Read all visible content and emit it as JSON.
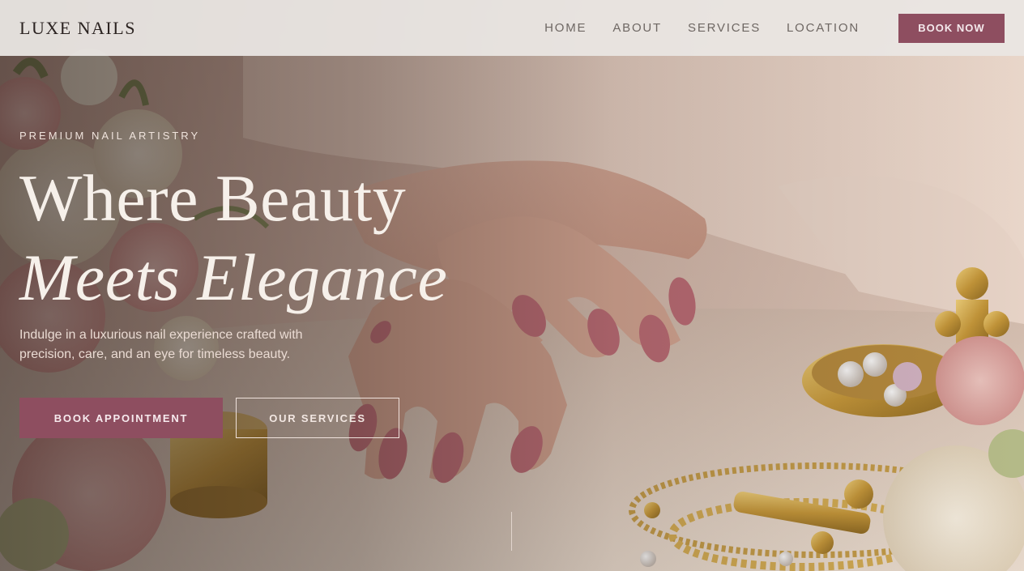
{
  "header": {
    "brand": "LUXE NAILS",
    "nav": [
      {
        "label": "HOME"
      },
      {
        "label": "ABOUT"
      },
      {
        "label": "SERVICES"
      },
      {
        "label": "LOCATION"
      }
    ],
    "book_now_label": "BOOK NOW"
  },
  "hero": {
    "eyebrow": "PREMIUM NAIL ARTISTRY",
    "headline_line_1": "Where Beauty",
    "headline_line_2": "Meets Elegance",
    "subtext": "Indulge in a luxurious nail experience crafted with precision, care, and an eye for timeless beauty.",
    "primary_cta": "BOOK APPOINTMENT",
    "secondary_cta": "OUR SERVICES"
  },
  "colors": {
    "accent": "#8e4e60",
    "header_bg": "#ece8e5",
    "headline_text": "#f6f0ea"
  }
}
